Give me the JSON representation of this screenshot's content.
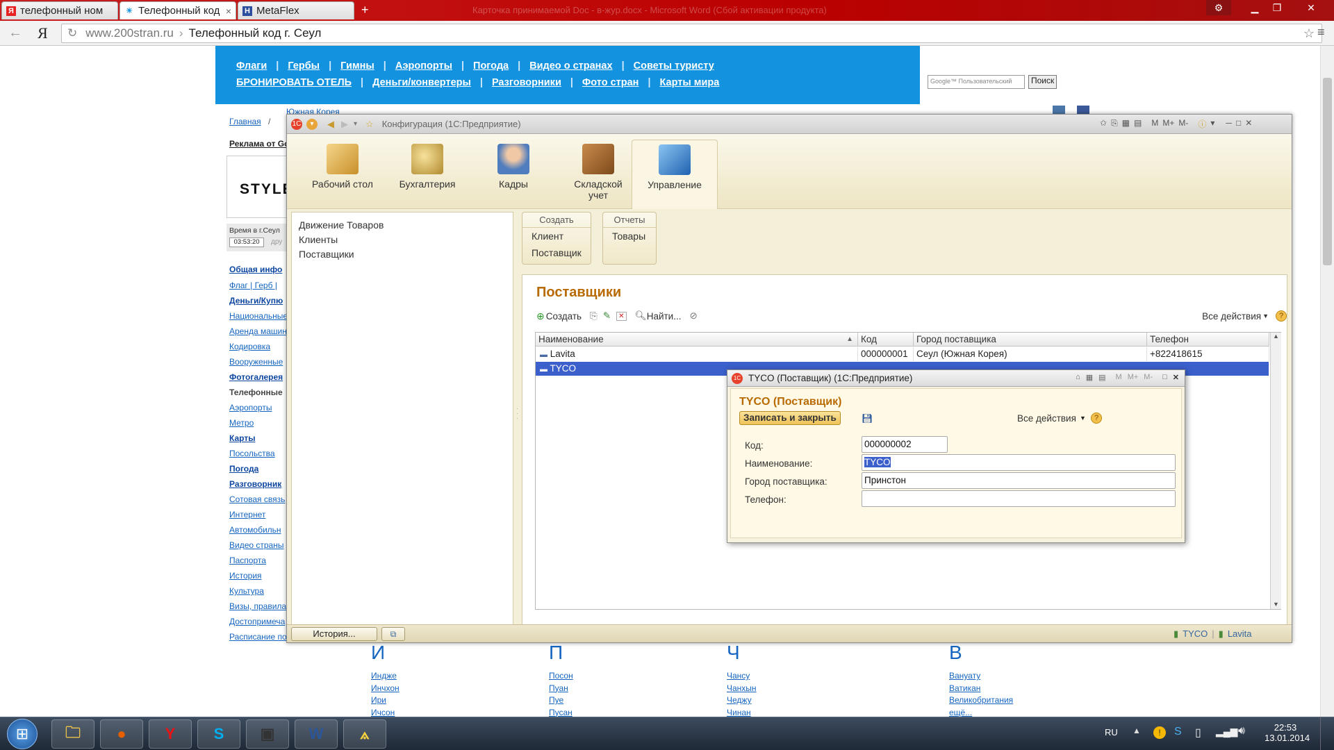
{
  "browser": {
    "tabs": [
      {
        "label": "телефонный ном",
        "favicon": "Я",
        "color": "#e62222"
      },
      {
        "label": "Телефонный код",
        "favicon": "☀",
        "color": "#1393df"
      },
      {
        "label": "MetaFlex",
        "favicon": "Н",
        "color": "#2a4f9e"
      }
    ],
    "new_tab": "+",
    "window_title_faded": "Карточка принимаемой Doc - в-жур.docx - Microsoft Word (Сбой активации продукта)",
    "url_domain": "www.200stran.ru",
    "url_sep": "›",
    "url_title": "Телефонный код г. Сеул",
    "yandex_logo": "Я",
    "back_arrow": "←",
    "reload": "↻",
    "star": "☆",
    "menu": "≡"
  },
  "site": {
    "nav_row1": [
      "Флаги",
      "Гербы",
      "Гимны",
      "Аэропорты",
      "Погода",
      "Видео о странах",
      "Советы туристу"
    ],
    "nav_row2": [
      "БРОНИРОВАТЬ ОТЕЛЬ",
      "Деньги/конвертеры",
      "Разговорники",
      "Фото стран",
      "Карты мира"
    ],
    "google_placeholder": "Google™ Пользовательский",
    "search_button": "Поиск",
    "breadcrumb_home": "Главная",
    "breadcrumb_sep": "/",
    "breadcrumb_current": "Южная Корея",
    "ad_label": "Реклама от Go",
    "ad_text": "STYLE",
    "time_label": "Время в г.Сеул",
    "time_value": "03:53:20",
    "time_other": "дру",
    "side_links": [
      {
        "label": "Общая инфо",
        "style": "bold"
      },
      {
        "label": "Флаг | Герб |",
        "style": "link"
      },
      {
        "label": "Деньги/Купю",
        "style": "bold"
      },
      {
        "label": "Национальные",
        "style": "link"
      },
      {
        "label": "Аренда машин",
        "style": "link"
      },
      {
        "label": "Кодировка",
        "style": "link"
      },
      {
        "label": "Вооруженные",
        "style": "link"
      },
      {
        "label": "Фотогалерея",
        "style": "bold"
      },
      {
        "label": "Телефонные",
        "style": "plain"
      },
      {
        "label": "Аэропорты",
        "style": "link"
      },
      {
        "label": "Метро",
        "style": "link"
      },
      {
        "label": "Карты",
        "style": "bold"
      },
      {
        "label": "Посольства",
        "style": "link"
      },
      {
        "label": "Погода",
        "style": "bold"
      },
      {
        "label": "Разговорник",
        "style": "bold"
      },
      {
        "label": "Сотовая связь",
        "style": "link"
      },
      {
        "label": "Интернет",
        "style": "link"
      },
      {
        "label": "Автомобильн",
        "style": "link"
      },
      {
        "label": "Видео страны",
        "style": "link"
      },
      {
        "label": "Паспорта",
        "style": "link"
      },
      {
        "label": "История",
        "style": "link"
      },
      {
        "label": "Культура",
        "style": "link"
      },
      {
        "label": "Визы, правила",
        "style": "link"
      },
      {
        "label": "Достопримеча",
        "style": "link"
      },
      {
        "label": "Расписание по",
        "style": "link"
      }
    ],
    "bottom_columns": [
      {
        "letter": "И",
        "items": [
          "Индже",
          "Инчхон",
          "Ири",
          "Ичсон"
        ]
      },
      {
        "letter": "П",
        "items": [
          "Посон",
          "Пуан",
          "Пуе",
          "Пусан"
        ]
      },
      {
        "letter": "Ч",
        "items": [
          "Чансу",
          "Чанхын",
          "Чеджу",
          "Чинан"
        ]
      },
      {
        "letter": "В",
        "items": [
          "Вануату",
          "Ватикан",
          "Великобритания",
          "ещё..."
        ]
      }
    ]
  },
  "app": {
    "title": "Конфигурация (1С:Предприятие)",
    "title_right_icons": [
      "M",
      "M+",
      "M-"
    ],
    "sections": [
      {
        "label": "Рабочий стол",
        "icon": "desk-icon",
        "color": "#d9a43a"
      },
      {
        "label": "Бухгалтерия",
        "icon": "coins-icon",
        "color": "#c8a040"
      },
      {
        "label": "Кадры",
        "icon": "people-icon",
        "color": "#5a88c6"
      },
      {
        "label": "Складской учет",
        "icon": "warehouse-icon",
        "color": "#a0642a"
      },
      {
        "label": "Управление",
        "icon": "building-icon",
        "color": "#2f7fd1"
      }
    ],
    "left_nav": [
      "Движение Товаров",
      "Клиенты",
      "Поставщики"
    ],
    "create_group": {
      "header": "Создать",
      "items": [
        "Клиент",
        "Поставщик"
      ]
    },
    "reports_group": {
      "header": "Отчеты",
      "items": [
        "Товары"
      ]
    },
    "list": {
      "title": "Поставщики",
      "create_label": "Создать",
      "find_label": "Найти...",
      "all_actions": "Все действия",
      "help": "?",
      "columns": [
        "Наименование",
        "Код",
        "Город поставщика",
        "Телефон"
      ],
      "rows": [
        {
          "name": "Lavita",
          "code": "000000001",
          "city": "Сеул (Южная Корея)",
          "phone": "+822418615",
          "selected": false
        },
        {
          "name": "TYCO",
          "code": "",
          "city": "",
          "phone": "",
          "selected": true
        }
      ]
    },
    "history_button": "История...",
    "status_items": [
      "TYCO",
      "Lavita"
    ],
    "accent_orange": "#b86a00",
    "selection_blue": "#3b5fcb"
  },
  "dialog": {
    "title": "TYCO (Поставщик)  (1С:Предприятие)",
    "heading": "TYCO (Поставщик)",
    "save_close": "Записать и закрыть",
    "all_actions": "Все действия",
    "help": "?",
    "title_icons": [
      "M",
      "M+",
      "M-"
    ],
    "fields": [
      {
        "label": "Код:",
        "value": "000000002"
      },
      {
        "label": "Наименование:",
        "value": "TYCO"
      },
      {
        "label": "Город поставщика:",
        "value": "Принстон"
      },
      {
        "label": "Телефон:",
        "value": ""
      }
    ]
  },
  "taskbar": {
    "start": "⊞",
    "apps": [
      {
        "name": "explorer-icon",
        "glyph": "🗀",
        "color": "#e8c04a"
      },
      {
        "name": "firefox-icon",
        "glyph": "●",
        "color": "#e66000"
      },
      {
        "name": "yandex-browser-icon",
        "glyph": "Y",
        "color": "#e11"
      },
      {
        "name": "skype-icon",
        "glyph": "S",
        "color": "#00aff0"
      },
      {
        "name": "app-window-icon",
        "glyph": "▣",
        "color": "#333"
      },
      {
        "name": "word-icon",
        "glyph": "W",
        "color": "#2b579a"
      },
      {
        "name": "1c-icon",
        "glyph": "⟑",
        "color": "#f7d23e"
      }
    ],
    "language": "RU",
    "time": "22:53",
    "date": "13.01.2014"
  }
}
